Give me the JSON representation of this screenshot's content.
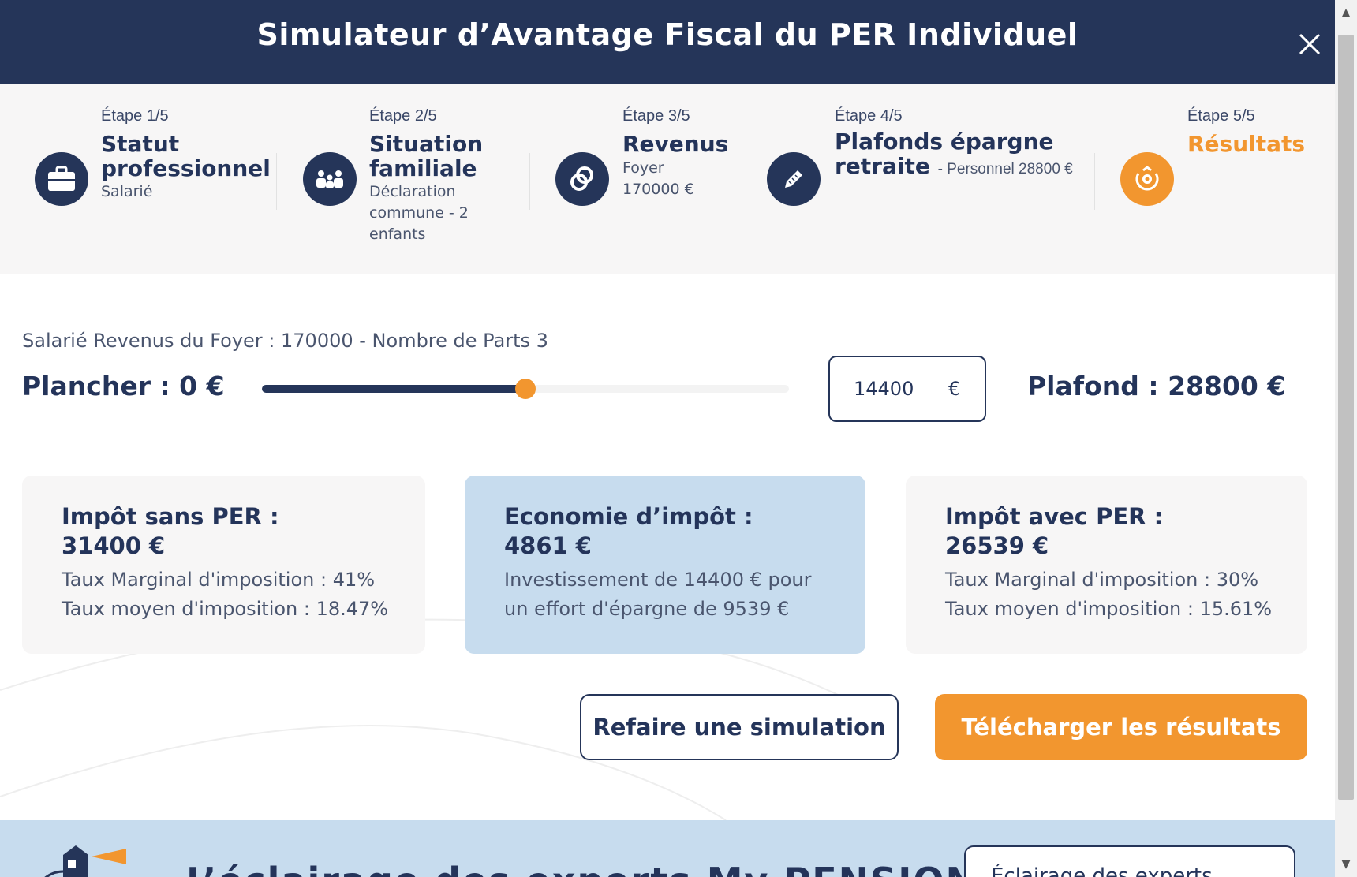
{
  "header": {
    "title": "Simulateur d’Avantage Fiscal du PER Individuel"
  },
  "steps": [
    {
      "step_label": "Étape 1/5",
      "title_lines": [
        "Statut",
        "professionnel"
      ],
      "sub_lines": [
        "Salarié"
      ],
      "icon": "briefcase-icon"
    },
    {
      "step_label": "Étape 2/5",
      "title_lines": [
        "Situation",
        "familiale"
      ],
      "sub_lines": [
        "Déclaration",
        "commune - 2",
        "enfants"
      ],
      "icon": "family-icon"
    },
    {
      "step_label": "Étape 3/5",
      "title_lines": [
        "Revenus"
      ],
      "sub_lines": [
        "Foyer",
        "170000 €"
      ],
      "icon": "coins-icon"
    },
    {
      "step_label": "Étape 4/5",
      "title_lines": [
        "Plafonds épargne",
        "retraite"
      ],
      "inline_sub": "- Personnel 28800 €",
      "icon": "pencil-icon"
    },
    {
      "step_label": "Étape 5/5",
      "title_lines": [
        "Résultats"
      ],
      "icon": "award-icon",
      "active": true
    }
  ],
  "summary": "Salarié Revenus du Foyer : 170000 - Nombre de Parts 3",
  "range": {
    "floor_label": "Plancher : 0 €",
    "ceiling_label": "Plafond : 28800 €",
    "min": 0,
    "max": 28800,
    "value": 14400,
    "input_value": "14400",
    "unit": "€"
  },
  "cards": [
    {
      "title_lines": [
        "Impôt sans PER :",
        "31400 €"
      ],
      "lines": [
        "Taux Marginal d'imposition : 41%",
        "Taux moyen d'imposition : 18.47%"
      ]
    },
    {
      "title_lines": [
        "Economie d’impôt :",
        "4861 €"
      ],
      "lines": [
        "Investissement de 14400 € pour",
        "un effort d'épargne de 9539 €"
      ]
    },
    {
      "title_lines": [
        "Impôt avec PER :",
        "26539 €"
      ],
      "lines": [
        "Taux Marginal d'imposition : 30%",
        "Taux moyen d'imposition : 15.61%"
      ]
    }
  ],
  "buttons": {
    "redo": "Refaire une simulation",
    "download": "Télécharger les résultats"
  },
  "banner": {
    "title": "L’éclairage des experts My PENSION",
    "button": "Éclairage des experts"
  },
  "colors": {
    "navy": "#253559",
    "orange": "#f2962f",
    "light_blue": "#c7dcee",
    "light_gray": "#f7f6f6"
  }
}
